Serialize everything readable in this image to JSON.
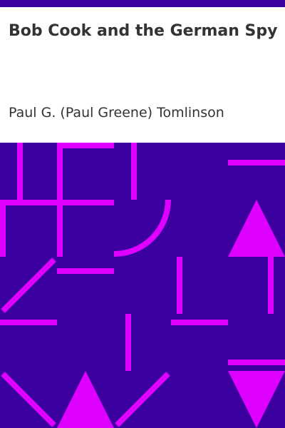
{
  "book": {
    "title": "Bob Cook and the German Spy",
    "author": "Paul G. (Paul Greene) Tomlinson"
  },
  "colors": {
    "top_bar": "#3c00a0",
    "pattern_background": "#3c00a0",
    "pattern_foreground": "#e000ff",
    "text": "#333333"
  }
}
